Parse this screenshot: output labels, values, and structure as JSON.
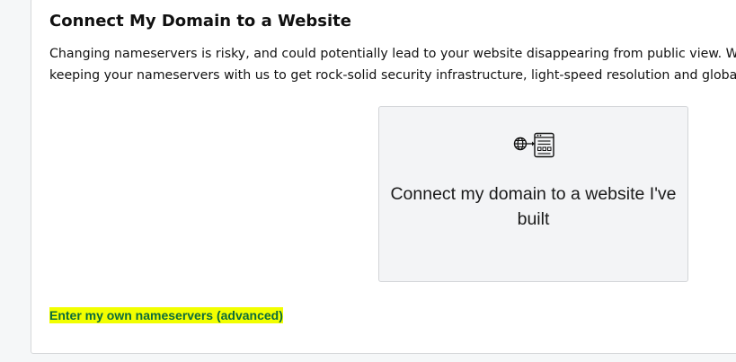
{
  "section": {
    "title": "Connect My Domain to a Website",
    "description_line1": "Changing nameservers is risky, and could potentially lead to your website disappearing from public view. We",
    "description_line2": "keeping your nameservers with us to get rock-solid security infrastructure, light-speed resolution and globa"
  },
  "option_card": {
    "icon": "globe-to-website-icon",
    "label": "Connect my domain to a website I've built"
  },
  "advanced_link": {
    "label": "Enter my own nameservers (advanced)",
    "highlight_color": "#f2ff00",
    "text_color": "#0a6b3c"
  }
}
